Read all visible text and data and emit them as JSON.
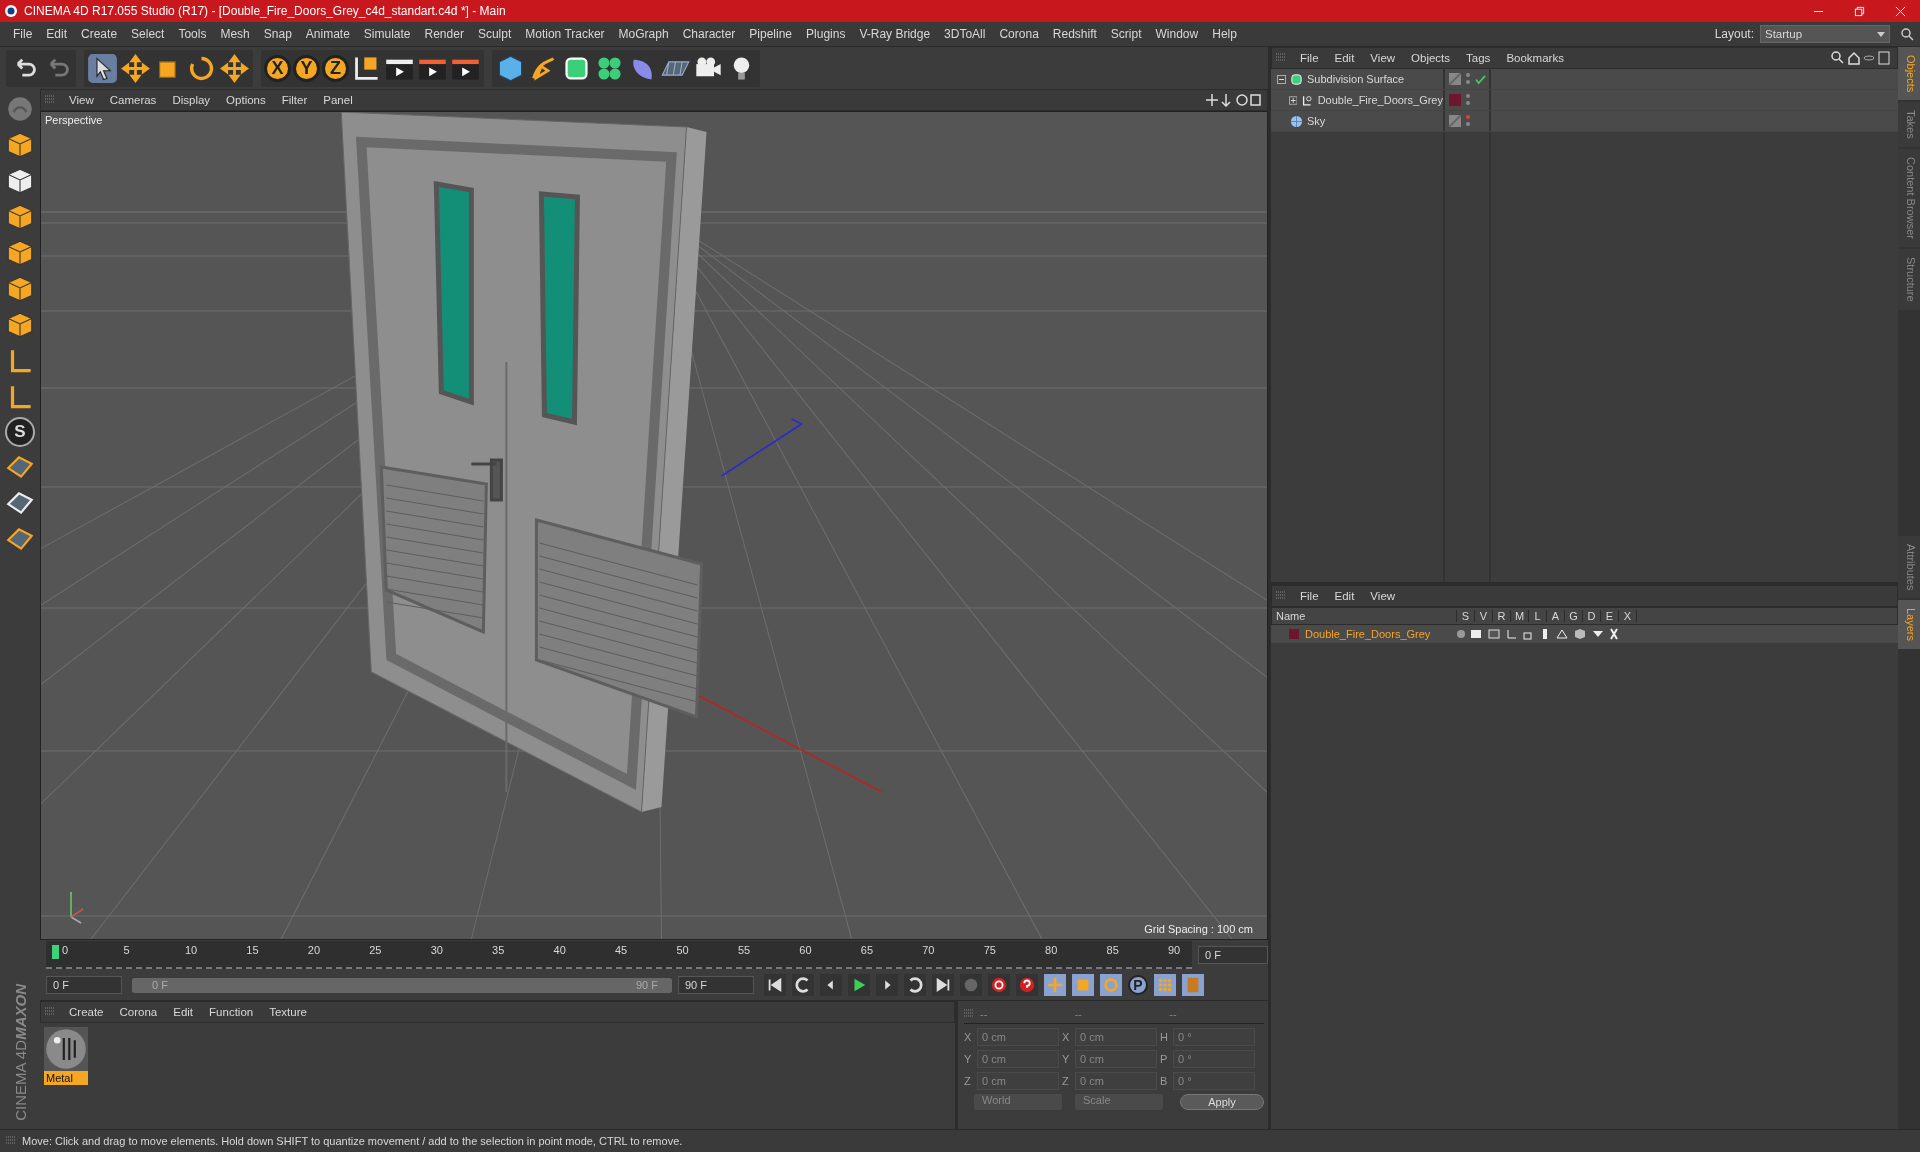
{
  "window": {
    "title": "CINEMA 4D R17.055 Studio (R17) - [Double_Fire_Doors_Grey_c4d_standart.c4d *] - Main"
  },
  "menu": [
    "File",
    "Edit",
    "Create",
    "Select",
    "Tools",
    "Mesh",
    "Snap",
    "Animate",
    "Simulate",
    "Render",
    "Sculpt",
    "Motion Tracker",
    "MoGraph",
    "Character",
    "Pipeline",
    "Plugins",
    "V-Ray Bridge",
    "3DToAll",
    "Corona",
    "Redshift",
    "Script",
    "Window",
    "Help"
  ],
  "layout": {
    "label": "Layout:",
    "value": "Startup"
  },
  "toolbar": {
    "axis_buttons": [
      "X",
      "Y",
      "Z"
    ]
  },
  "left_toolbar": {
    "snap_glyph": "S"
  },
  "logo": {
    "brand": "MAXON",
    "product": "CINEMA 4D"
  },
  "viewport": {
    "menu": [
      "View",
      "Cameras",
      "Display",
      "Options",
      "Filter",
      "Panel"
    ],
    "camera": "Perspective",
    "grid_spacing": "Grid Spacing : 100 cm"
  },
  "timeline": {
    "ticks": [
      "0",
      "5",
      "10",
      "15",
      "20",
      "25",
      "30",
      "35",
      "40",
      "45",
      "50",
      "55",
      "60",
      "65",
      "70",
      "75",
      "80",
      "85",
      "90"
    ],
    "current_frame": "0 F",
    "start": "0 F",
    "range": {
      "level": 1,
      "start": "0 F",
      "end": "90 F"
    },
    "end": "90 F",
    "param_glyph": "P"
  },
  "materials": {
    "menu": [
      "Create",
      "Corona",
      "Edit",
      "Function",
      "Texture"
    ],
    "items": [
      {
        "name": "Metal",
        "selected": true
      }
    ]
  },
  "coordinates": {
    "headers": [
      "--",
      "--",
      "--"
    ],
    "rows": [
      {
        "a": "X",
        "av": "0 cm",
        "b": "X",
        "bv": "0 cm",
        "c": "H",
        "cv": "0 °"
      },
      {
        "a": "Y",
        "av": "0 cm",
        "b": "Y",
        "bv": "0 cm",
        "c": "P",
        "cv": "0 °"
      },
      {
        "a": "Z",
        "av": "0 cm",
        "b": "Z",
        "bv": "0 cm",
        "c": "B",
        "cv": "0 °"
      }
    ],
    "space": "World",
    "mode": "Scale",
    "apply": "Apply"
  },
  "objects": {
    "menu": [
      "File",
      "Edit",
      "View",
      "Objects",
      "Tags",
      "Bookmarks"
    ],
    "tree": [
      {
        "name": "Subdivision Surface",
        "kind": "subdivision",
        "expanded": true,
        "enabled": true,
        "children": [
          {
            "name": "Double_Fire_Doors_Grey",
            "kind": "null",
            "expanded": false,
            "color": "#6e1530"
          }
        ]
      },
      {
        "name": "Sky",
        "kind": "sky"
      }
    ]
  },
  "layers": {
    "menu": [
      "File",
      "Edit",
      "View"
    ],
    "columns": [
      "Name",
      "S",
      "V",
      "R",
      "M",
      "L",
      "A",
      "G",
      "D",
      "E",
      "X"
    ],
    "items": [
      {
        "name": "Double_Fire_Doors_Grey",
        "color": "#6e1530"
      }
    ]
  },
  "side_tabs_top": [
    {
      "label": "Objects",
      "selected": true
    },
    {
      "label": "Takes",
      "selected": false
    },
    {
      "label": "Content Browser",
      "selected": false
    },
    {
      "label": "Structure",
      "selected": false
    }
  ],
  "side_tabs_bottom": [
    {
      "label": "Attributes",
      "selected": false
    },
    {
      "label": "Layers",
      "selected": true
    }
  ],
  "status_bar": "Move: Click and drag to move elements. Hold down SHIFT to quantize movement / add to the selection in point mode, CTRL to remove."
}
